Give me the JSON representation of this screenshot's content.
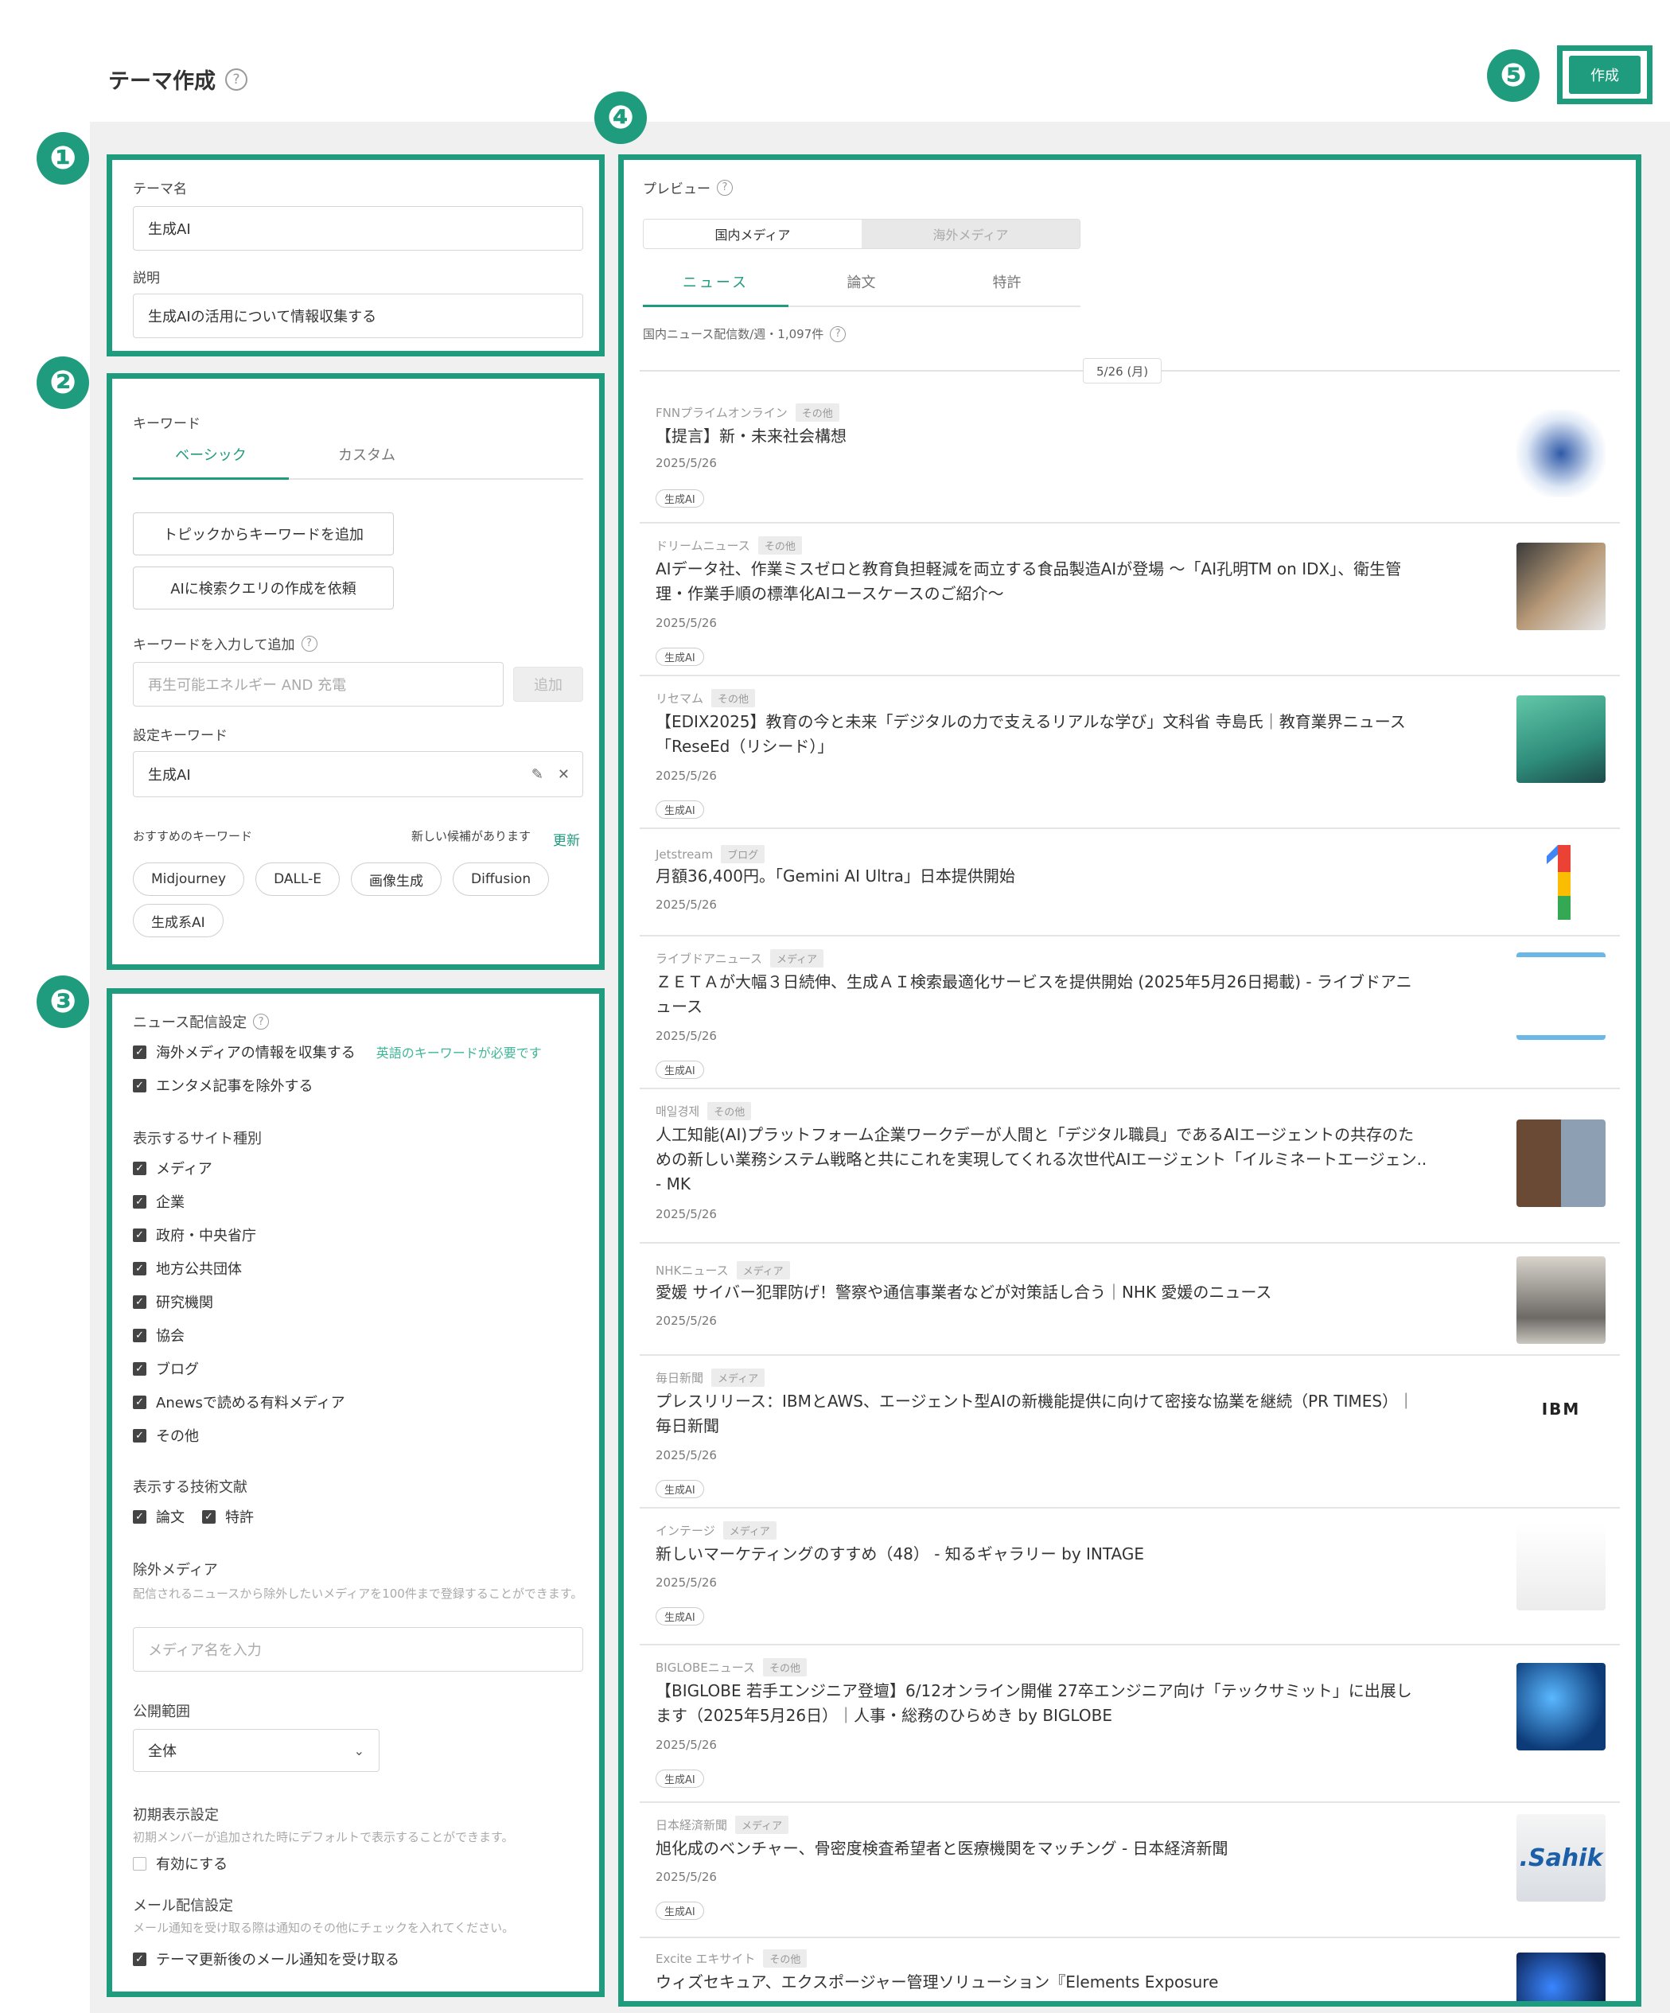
{
  "header": {
    "title": "テーマ作成",
    "create_label": "作成"
  },
  "badges": [
    "❶",
    "❷",
    "❸",
    "❹",
    "❺"
  ],
  "panel1": {
    "name_label": "テーマ名",
    "name_value": "生成AI",
    "desc_label": "説明",
    "desc_value": "生成AIの活用について情報収集する"
  },
  "panel2": {
    "keyword_label": "キーワード",
    "tabs": [
      "ベーシック",
      "カスタム"
    ],
    "add_from_topic": "トピックからキーワードを追加",
    "ask_ai": "AIに検索クエリの作成を依頼",
    "input_label": "キーワードを入力して追加",
    "input_placeholder": "再生可能エネルギー AND 充電",
    "add_button": "追加",
    "set_label": "設定キーワード",
    "set_value": "生成AI",
    "recommend_label": "おすすめのキーワード",
    "new_candidates": "新しい候補があります",
    "update_link": "更新",
    "chips": [
      "Midjourney",
      "DALL-E",
      "画像生成",
      "Diffusion",
      "生成系AI"
    ]
  },
  "panel3": {
    "news_settings": "ニュース配信設定",
    "collect_overseas": "海外メディアの情報を収集する",
    "english_note": "英語のキーワードが必要です",
    "exclude_ent": "エンタメ記事を除外する",
    "site_types_label": "表示するサイト種別",
    "site_types": [
      "メディア",
      "企業",
      "政府・中央省庁",
      "地方公共団体",
      "研究機関",
      "協会",
      "ブログ",
      "Anewsで読める有料メディア",
      "その他"
    ],
    "tech_label": "表示する技術文献",
    "tech_items": [
      "論文",
      "特許"
    ],
    "exclude_media_label": "除外メディア",
    "exclude_media_note": "配信されるニュースから除外したいメディアを100件まで登録することができます。",
    "exclude_media_placeholder": "メディア名を入力",
    "scope_label": "公開範囲",
    "scope_value": "全体",
    "initial_label": "初期表示設定",
    "initial_note": "初期メンバーが追加された時にデフォルトで表示することができます。",
    "enable": "有効にする",
    "mail_label": "メール配信設定",
    "mail_note": "メール通知を受け取る際は通知のその他にチェックを入れてください。",
    "mail_receive": "テーマ更新後のメール通知を受け取る"
  },
  "preview": {
    "label": "プレビュー",
    "segments": [
      "国内メディア",
      "海外メディア"
    ],
    "tabs": [
      "ニュース",
      "論文",
      "特許"
    ],
    "count_text": "国内ニュース配信数/週・1,097件",
    "date_sep": "5/26 (月)",
    "items": [
      {
        "source": "FNNプライムオンライン",
        "tag": "その他",
        "title": "【提言】新・未来社会構想",
        "date": "2025/5/26",
        "kw": "生成AI"
      },
      {
        "source": "ドリームニュース",
        "tag": "その他",
        "title": "AIデータ社、作業ミスゼロと教育負担軽減を両立する食品製造AIが登場 ～「AI孔明TM on IDX」、衛生管理・作業手順の標準化AIユースケースのご紹介～",
        "date": "2025/5/26",
        "kw": "生成AI"
      },
      {
        "source": "リセマム",
        "tag": "その他",
        "title": "【EDIX2025】教育の今と未来「デジタルの力で支えるリアルな学び」文科省 寺島氏｜教育業界ニュース「ReseEd（リシード）」",
        "date": "2025/5/26",
        "kw": "生成AI"
      },
      {
        "source": "Jetstream",
        "tag": "ブログ",
        "title": "月額36,400円。「Gemini AI Ultra」日本提供開始",
        "date": "2025/5/26",
        "kw": ""
      },
      {
        "source": "ライブドアニュース",
        "tag": "メディア",
        "title": "ＺＥＴＡが大幅３日続伸、生成ＡＩ検索最適化サービスを提供開始 (2025年5月26日掲載) - ライブドアニュース",
        "date": "2025/5/26",
        "kw": "生成AI"
      },
      {
        "source": "매일경제",
        "tag": "その他",
        "title": "人工知能(AI)プラットフォーム企業ワークデーが人間と「デジタル職員」であるAIエージェントの共存のための新しい業務システム戦略と共にこれを実現してくれる次世代AIエージェント「イルミネートエージェン.. - MK",
        "date": "2025/5/26",
        "kw": ""
      },
      {
        "source": "NHKニュース",
        "tag": "メディア",
        "title": "愛媛 サイバー犯罪防げ！警察や通信事業者などが対策話し合う｜NHK 愛媛のニュース",
        "date": "2025/5/26",
        "kw": ""
      },
      {
        "source": "毎日新聞",
        "tag": "メディア",
        "title": "プレスリリース：IBMとAWS、エージェント型AIの新機能提供に向けて密接な協業を継続（PR TIMES）｜毎日新聞",
        "date": "2025/5/26",
        "kw": "生成AI"
      },
      {
        "source": "インテージ",
        "tag": "メディア",
        "title": "新しいマーケティングのすすめ（48） - 知るギャラリー by INTAGE",
        "date": "2025/5/26",
        "kw": "生成AI"
      },
      {
        "source": "BIGLOBEニュース",
        "tag": "その他",
        "title": "【BIGLOBE 若手エンジニア登壇】6/12オンライン開催 27卒エンジニア向け「テックサミット」に出展します（2025年5月26日）｜人事・総務のひらめき by BIGLOBE",
        "date": "2025/5/26",
        "kw": "生成AI"
      },
      {
        "source": "日本経済新聞",
        "tag": "メディア",
        "title": "旭化成のベンチャー、骨密度検査希望者と医療機関をマッチング - 日本経済新聞",
        "date": "2025/5/26",
        "kw": "生成AI"
      },
      {
        "source": "Excite エキサイト",
        "tag": "その他",
        "title": "ウィズセキュア、エクスポージャー管理ソリューション『Elements Exposure",
        "date": "",
        "kw": ""
      }
    ],
    "thumb_texts": [
      "IBM",
      ".Sahik"
    ]
  },
  "colors": {
    "accent": "#1f9b7d",
    "text": "#333333",
    "muted": "#999999"
  }
}
